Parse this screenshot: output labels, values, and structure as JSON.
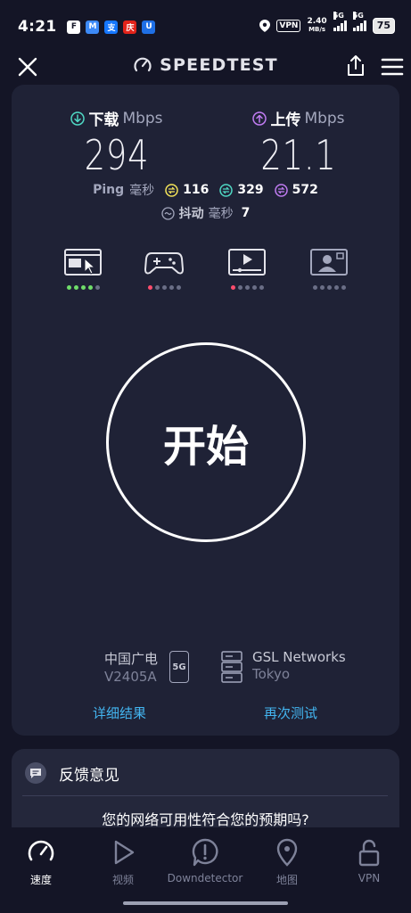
{
  "status": {
    "time": "4:21",
    "app_icons": [
      "F",
      "M",
      "支",
      "庆",
      "U"
    ],
    "vpn": "VPN",
    "net_speed_value": "2.40",
    "net_speed_unit": "MB/s",
    "sim1": "5G",
    "sim2": "5G",
    "battery": "75"
  },
  "header": {
    "title": "SPEEDTEST"
  },
  "results": {
    "download_label": "下载",
    "download_unit": "Mbps",
    "download_value": "294",
    "upload_label": "上传",
    "upload_unit": "Mbps",
    "upload_value": "21.1",
    "ping_label": "Ping",
    "ping_unit": "毫秒",
    "ping_idle": "116",
    "ping_download": "329",
    "ping_upload": "572",
    "jitter_label": "抖动",
    "jitter_unit": "毫秒",
    "jitter_value": "7"
  },
  "experience": {
    "items": [
      {
        "name": "browsing",
        "icon": "browser-cursor-icon",
        "level": 4,
        "color": "#6fdd6a"
      },
      {
        "name": "gaming",
        "icon": "gamepad-icon",
        "level": 1,
        "color": "#ff4d6d"
      },
      {
        "name": "video",
        "icon": "video-player-icon",
        "level": 1,
        "color": "#ff4d6d"
      },
      {
        "name": "video-call",
        "icon": "video-call-icon",
        "level": 0,
        "color": "#6a6e86"
      }
    ]
  },
  "start_button": "开始",
  "provider": {
    "isp_name": "中国广电",
    "isp_device": "V2405A",
    "isp_badge": "5G",
    "server_name": "GSL Networks",
    "server_city": "Tokyo"
  },
  "links": {
    "details": "详细结果",
    "retest": "再次测试"
  },
  "feedback": {
    "title": "反馈意见",
    "question": "您的网络可用性符合您的预期吗?"
  },
  "nav": {
    "items": [
      {
        "label": "速度",
        "icon": "speedometer-icon"
      },
      {
        "label": "视频",
        "icon": "play-icon"
      },
      {
        "label": "Downdetector",
        "icon": "alert-bubble-icon"
      },
      {
        "label": "地图",
        "icon": "map-pin-icon"
      },
      {
        "label": "VPN",
        "icon": "lock-icon"
      }
    ],
    "active": 0
  },
  "colors": {
    "download_accent": "#4fd8c4",
    "upload_accent": "#c07cf2",
    "ping_idle": "#f3e35a",
    "ping_download": "#4fd8c4",
    "ping_upload": "#c07cf2",
    "link": "#43b5f0"
  }
}
